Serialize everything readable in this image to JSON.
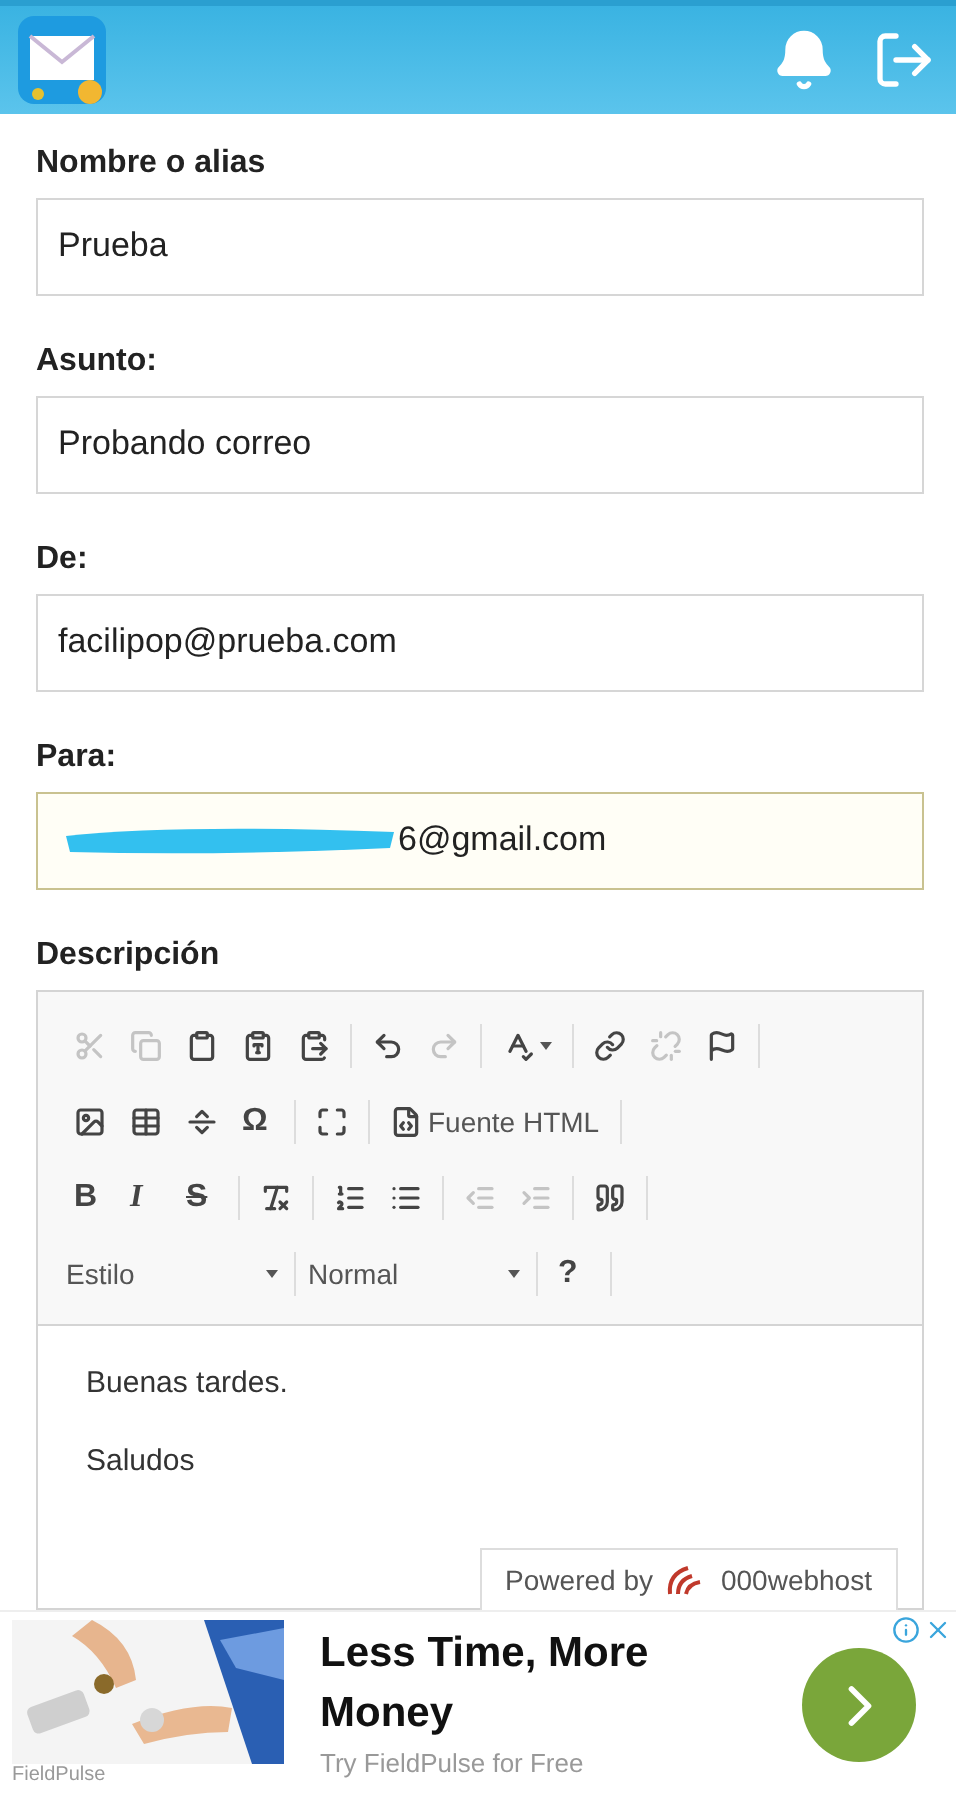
{
  "fields": [
    {
      "label": "Nombre o alias",
      "value": "Prueba",
      "focused": false
    },
    {
      "label": "Asunto:",
      "value": "Probando correo",
      "focused": false
    },
    {
      "label": "De:",
      "value": "facilipop@prueba.com",
      "focused": false
    },
    {
      "label": "Para:",
      "value": "6@gmail.com",
      "focused": true,
      "redacted": true
    }
  ],
  "editor": {
    "label": "Descripción",
    "toolbar": [
      [
        [
          {
            "kind": "icon",
            "disabled": true
          },
          {
            "kind": "icon",
            "disabled": true
          },
          {
            "kind": "icon",
            "disabled": false
          },
          {
            "kind": "icon",
            "disabled": false
          },
          {
            "kind": "icon",
            "disabled": false
          }
        ],
        [
          {
            "kind": "icon",
            "disabled": false
          },
          {
            "kind": "icon",
            "disabled": true
          }
        ],
        [
          {
            "kind": "icon-menu",
            "disabled": false
          }
        ],
        [
          {
            "kind": "icon",
            "disabled": false
          },
          {
            "kind": "icon",
            "disabled": true
          },
          {
            "kind": "icon",
            "disabled": false
          }
        ]
      ],
      [
        [
          {
            "kind": "icon",
            "disabled": false
          },
          {
            "kind": "icon",
            "disabled": false
          },
          {
            "kind": "icon",
            "disabled": false
          },
          {
            "kind": "glyph",
            "label": "Ω",
            "disabled": false
          }
        ],
        [
          {
            "kind": "icon",
            "disabled": false
          }
        ],
        [
          {
            "kind": "icon-text",
            "label": "Fuente HTML",
            "disabled": false
          }
        ]
      ],
      [
        [
          {
            "kind": "glyph",
            "label": "B",
            "disabled": false
          },
          {
            "kind": "glyph",
            "label": "I",
            "disabled": false
          },
          {
            "kind": "glyph",
            "label": "S",
            "disabled": false
          }
        ],
        [
          {
            "kind": "icon",
            "disabled": false
          }
        ],
        [
          {
            "kind": "icon",
            "disabled": false
          },
          {
            "kind": "icon",
            "disabled": false
          }
        ],
        [
          {
            "kind": "icon",
            "disabled": true
          },
          {
            "kind": "icon",
            "disabled": true
          }
        ],
        [
          {
            "kind": "icon",
            "disabled": false
          }
        ]
      ],
      [
        [
          {
            "kind": "dropdown",
            "label": "Estilo",
            "disabled": false
          }
        ],
        [
          {
            "kind": "dropdown",
            "label": "Normal",
            "disabled": false
          }
        ],
        [
          {
            "kind": "glyph",
            "label": "?",
            "disabled": false
          }
        ]
      ]
    ],
    "content": [
      "Buenas tardes.",
      "Saludos"
    ]
  },
  "badge": {
    "prefix": "Powered by",
    "brand": "000webhost"
  },
  "ad": {
    "kind": "picture",
    "title": "Less Time, More Money",
    "subtitle": "Try FieldPulse for Free",
    "brand": "FieldPulse"
  }
}
